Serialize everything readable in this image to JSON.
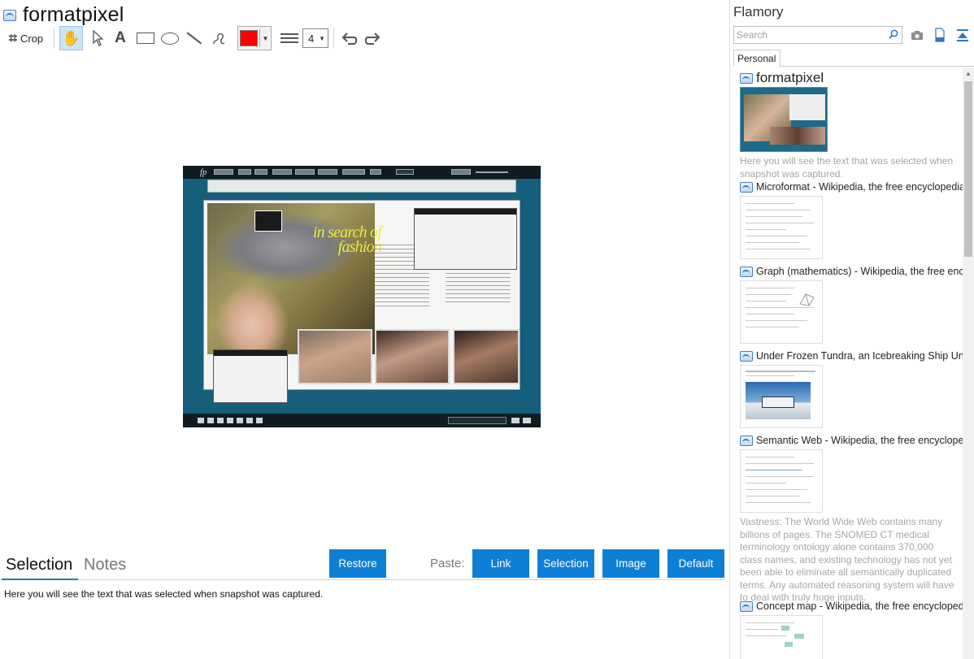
{
  "document": {
    "title": "formatpixel"
  },
  "toolbar": {
    "crop_label": "Crop",
    "line_width": "4",
    "color": "#ff0000"
  },
  "snapshot": {
    "logo_text": "fp",
    "headline": "in search of fashion"
  },
  "bottom": {
    "tabs": [
      "Selection",
      "Notes"
    ],
    "restore_label": "Restore",
    "paste_label": "Paste:",
    "paste_buttons": [
      "Link",
      "Selection",
      "Image",
      "Default"
    ],
    "selection_text": "Here you will see the text that was selected when snapshot was captured."
  },
  "sidebar": {
    "app_name": "Flamory",
    "search_placeholder": "Search",
    "tab_label": "Personal",
    "items": [
      {
        "title": "formatpixel",
        "desc": "Here you will see the text that was selected when snapshot was captured."
      },
      {
        "title": "Microformat - Wikipedia, the free encyclopedia"
      },
      {
        "title": "Graph (mathematics) - Wikipedia, the free ency"
      },
      {
        "title": "Under Frozen Tundra, an Icebreaking Ship Unco"
      },
      {
        "title": "Semantic Web - Wikipedia, the free encycloped",
        "desc": "Vastness: The World Wide Web contains many billions of pages. The SNOMED CT medical terminology ontology alone contains 370,000 class names, and existing technology has not yet been able to eliminate all semantically duplicated terms. Any automated reasoning system will have to deal with truly huge inputs."
      },
      {
        "title": "Concept map - Wikipedia, the free encyclopedi"
      }
    ]
  },
  "colors": {
    "accent": "#0f7fd6",
    "active_tab_underline": "#0e7cd3",
    "tool_active": "#cde4f7"
  }
}
